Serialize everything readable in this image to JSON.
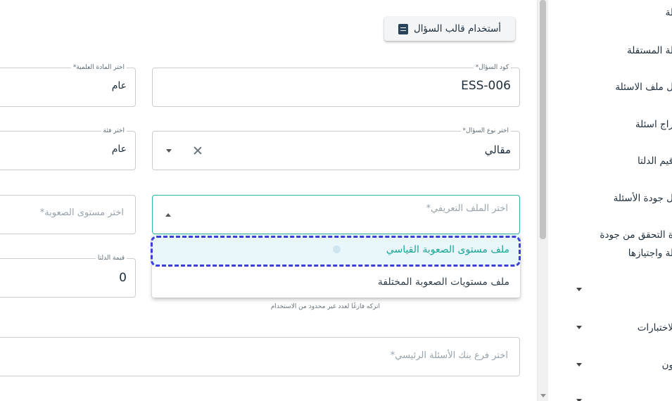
{
  "toolbar": {
    "template_button": "أستخدام قالب السؤال"
  },
  "form": {
    "question_code": {
      "label": "كود السؤال*",
      "value": "ESS-006"
    },
    "subject": {
      "label": "اختر المادة العلمية*",
      "value": "عام"
    },
    "question_type": {
      "label": "اختر نوع السؤال*",
      "value": "مقالي"
    },
    "category": {
      "label": "اختر فئة",
      "value": "عام"
    },
    "profile_file": {
      "placeholder": "اختر الملف التعريفي*",
      "options": [
        "ملف مستوى الصعوبة القياسي",
        "ملف مستويات الصعوبة المختلفة"
      ]
    },
    "difficulty": {
      "placeholder": "اختر مستوى الصعوبة*"
    },
    "delta": {
      "label": "قيمة الدلتا",
      "value": "0"
    },
    "hint": "اتركه فارغًا لعدد غير محدود من الاستخدام",
    "bank_branch": {
      "placeholder": "اختر فرع بنك الأسئلة الرئيسي*"
    }
  },
  "sidebar": {
    "items": [
      "لة",
      "لة المستقلة",
      "ل ملف الاسئلة",
      "راج اسئلة",
      "قيم الدلتا",
      "ل جودة الأسئلة",
      "ة التحقق من جودة",
      "لة واجتيازها",
      "لاختبارات",
      "ون"
    ]
  }
}
